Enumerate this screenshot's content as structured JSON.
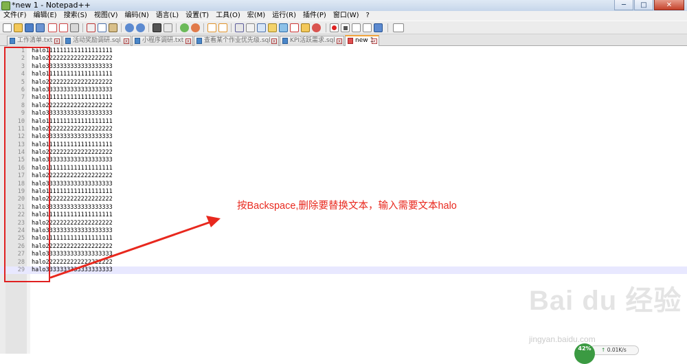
{
  "window": {
    "title": "*new 1 - Notepad++",
    "minimize_glyph": "─",
    "maximize_glyph": "□",
    "close_glyph": "✕"
  },
  "menu": [
    "文件(F)",
    "编辑(E)",
    "搜索(S)",
    "视图(V)",
    "编码(N)",
    "语言(L)",
    "设置(T)",
    "工具(O)",
    "宏(M)",
    "运行(R)",
    "插件(P)",
    "窗口(W)",
    "?"
  ],
  "tabs": [
    {
      "label": "工作清单.txt",
      "active": false
    },
    {
      "label": "活动奖励调研.sql",
      "active": false
    },
    {
      "label": "小程序调研.txt",
      "active": false
    },
    {
      "label": "查看某个作业优先级.sql",
      "active": false
    },
    {
      "label": "KPI活跃需求.sql",
      "active": false
    },
    {
      "label": "new 1",
      "active": true
    }
  ],
  "tab_close_glyph": "x",
  "editor": {
    "lines": [
      "halo1111111111111111111",
      "halo2222222222222222222",
      "halo3333333333333333333",
      "halo1111111111111111111",
      "halo2222222222222222222",
      "halo3333333333333333333",
      "halo1111111111111111111",
      "halo2222222222222222222",
      "halo3333333333333333333",
      "halo1111111111111111111",
      "halo2222222222222222222",
      "halo3333333333333333333",
      "halo1111111111111111111",
      "halo2222222222222222222",
      "halo3333333333333333333",
      "halo1111111111111111111",
      "halo2222222222222222222",
      "halo3333333333333333333",
      "halo1111111111111111111",
      "halo2222222222222222222",
      "halo3333333333333333333",
      "halo1111111111111111111",
      "halo2222222222222222222",
      "halo3333333333333333333",
      "halo1111111111111111111",
      "halo2222222222222222222",
      "halo3333333333333333333",
      "halo2222222222222222222",
      "halo3333333333333333333"
    ],
    "current_line": 29
  },
  "annotation": {
    "text": "按Backspace,删除要替换文本，输入需要文本halo",
    "color": "#e8281e"
  },
  "watermark": {
    "logo": "Bai du 经验",
    "url": "jingyan.baidu.com"
  },
  "network_widget": {
    "percent": "42%",
    "speed": "0.01K/s"
  },
  "toolbar_icons": [
    "new-file-icon",
    "open-file-icon",
    "save-icon",
    "save-all-icon",
    "close-icon",
    "close-all-icon",
    "print-icon",
    "cut-icon",
    "copy-icon",
    "paste-icon",
    "undo-icon",
    "redo-icon",
    "find-icon",
    "replace-icon",
    "zoom-in-icon",
    "zoom-out-icon",
    "sync-v-icon",
    "sync-h-icon",
    "wrap-icon",
    "all-chars-icon",
    "indent-guide-icon",
    "udl-icon",
    "doc-map-icon",
    "function-list-icon",
    "folder-workspace-icon",
    "monitor-icon",
    "record-macro-icon",
    "stop-macro-icon",
    "play-macro-icon",
    "play-multi-icon",
    "save-macro-icon",
    "spellcheck-icon"
  ]
}
